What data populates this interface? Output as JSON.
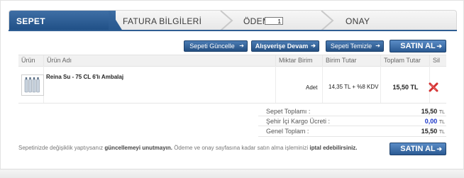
{
  "tabs": [
    {
      "label": "SEPET"
    },
    {
      "label": "FATURA BİLGİLERİ"
    },
    {
      "label": "ÖDEME"
    },
    {
      "label": "ONAY"
    }
  ],
  "colors": {
    "accent": "#244f82",
    "delete": "#d32f2f",
    "kargo": "#1a35c9"
  },
  "toolbar": {
    "update_label": "Sepeti Güncelle",
    "continue_label": "Alışverişe Devam",
    "clear_label": "Sepeti Temizle",
    "buy_label": "SATIN AL"
  },
  "table": {
    "headers": [
      "Ürün",
      "Ürün Adı",
      "Miktar Birim",
      "Birim Tutar",
      "Toplam Tutar",
      "Sil"
    ],
    "row": {
      "name": "Reina Su - 75 CL 6'lı Ambalaj",
      "quantity": "1",
      "unit": "Adet",
      "unit_price": "14,35 TL + %8 KDV",
      "total": "15,50 TL",
      "delete_icon": "red-x-icon",
      "image_icon": "product-bottles-icon"
    }
  },
  "summary": {
    "subtotal_label": "Sepet Toplamı :",
    "subtotal_value": "15,50",
    "shipping_label": "Şehir İçi Kargo Ücreti :",
    "shipping_value": "0,00",
    "total_label": "Genel Toplam :",
    "total_value": "15,50",
    "currency": "TL"
  },
  "footer": {
    "note_part1": "Sepetinizde değişiklik yaptıysanız ",
    "note_bold1": "güncellemeyi unutmayın.",
    "note_part2": " Ödeme ve onay sayfasına kadar satın alma işleminizi ",
    "note_bold2": "iptal edebilirsiniz.",
    "buy_label": "SATIN AL"
  }
}
